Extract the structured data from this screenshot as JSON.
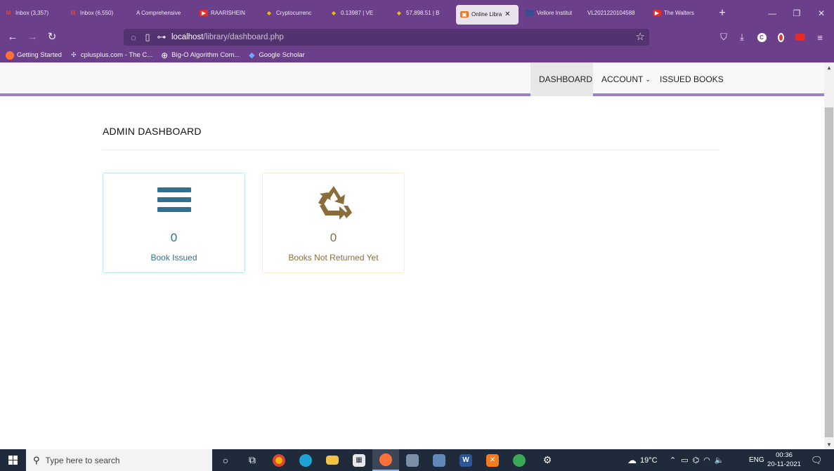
{
  "browser": {
    "tabs": [
      {
        "title": "Inbox (3,357)",
        "icon": "gmail-icon",
        "active": false
      },
      {
        "title": "Inbox (6,550)",
        "icon": "gmail-icon",
        "active": false
      },
      {
        "title": "A Comprehensive",
        "icon": "blank-icon",
        "active": false
      },
      {
        "title": "RAARISHEIN",
        "icon": "youtube-icon",
        "active": false
      },
      {
        "title": "Cryptocurrenc",
        "icon": "binance-icon",
        "active": false
      },
      {
        "title": "0.13987 | VE",
        "icon": "binance-icon",
        "active": false
      },
      {
        "title": "57,898.51 | B",
        "icon": "binance-icon",
        "active": false
      },
      {
        "title": "Online Libra",
        "icon": "library-icon",
        "active": true
      },
      {
        "title": "Vellore Institut",
        "icon": "vit-icon",
        "active": false
      },
      {
        "title": "VL2021220104588",
        "icon": "blank-icon",
        "active": false
      },
      {
        "title": "The Walters",
        "icon": "youtube-icon",
        "active": false
      }
    ],
    "url_host": "localhost",
    "url_path": "/library/dashboard.php",
    "bookmarks": [
      {
        "label": "Getting Started",
        "icon": "firefox-icon"
      },
      {
        "label": "cplusplus.com - The C...",
        "icon": "cplusplus-icon"
      },
      {
        "label": "Big-O Algorithm Com...",
        "icon": "globe-icon"
      },
      {
        "label": "Google Scholar",
        "icon": "scholar-icon"
      }
    ],
    "accent_color": "#6b3f8a"
  },
  "site": {
    "nav": {
      "dashboard": "DASHBOARD",
      "account": "ACCOUNT",
      "issued_books": "ISSUED BOOKS"
    },
    "page_title": "ADMIN DASHBOARD",
    "cards": [
      {
        "count": "0",
        "label": "Book Issued",
        "icon": "bars-icon",
        "color": "#31708f"
      },
      {
        "count": "0",
        "label": "Books Not Returned Yet",
        "icon": "recycle-icon",
        "color": "#8a6d3b"
      }
    ]
  },
  "taskbar": {
    "search_placeholder": "Type here to search",
    "weather": "19°C",
    "language": "ENG",
    "time": "00:36",
    "date": "20-11-2021"
  }
}
